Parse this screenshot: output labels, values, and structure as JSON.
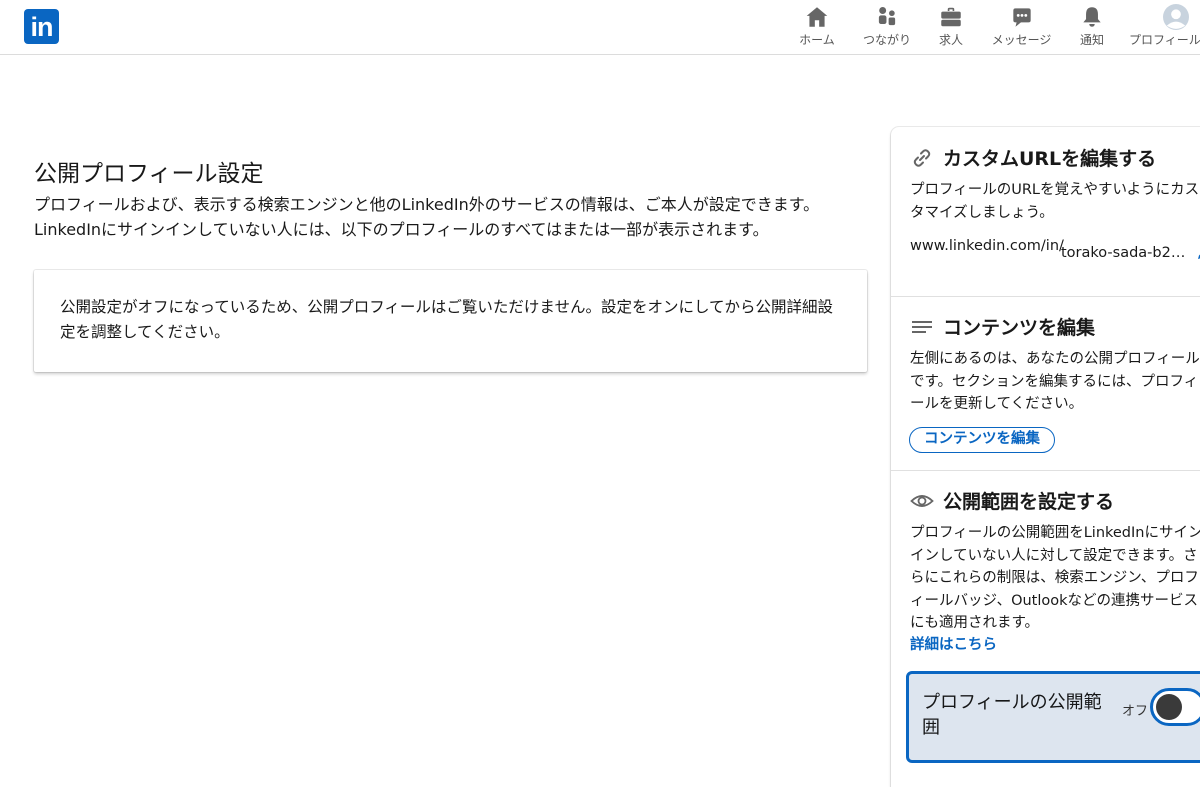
{
  "nav": {
    "logo": "in",
    "items": [
      {
        "label": "ホーム",
        "icon": "home-icon"
      },
      {
        "label": "つながり",
        "icon": "people-icon"
      },
      {
        "label": "求人",
        "icon": "briefcase-icon"
      },
      {
        "label": "メッセージ",
        "icon": "chat-icon"
      },
      {
        "label": "通知",
        "icon": "bell-icon"
      },
      {
        "label": "プロフィール",
        "icon": "avatar"
      }
    ]
  },
  "main": {
    "title": "公開プロフィール設定",
    "description": "プロフィールおよび、表示する検索エンジンと他のLinkedIn外のサービスの情報は、ご本人が設定できます。LinkedInにサインインしていない人には、以下のプロフィールのすべてはまたは一部が表示されます。",
    "notice": "公開設定がオフになっているため、公開プロフィールはご覧いただけません。設定をオンにしてから公開詳細設定を調整してください。"
  },
  "sidebar": {
    "custom_url": {
      "title": "カスタムURLを編集する",
      "body": "プロフィールのURLを覚えやすいようにカスタマイズしましょう。",
      "url_prefix": "www.linkedin.com/in/",
      "url_slug": "torako-sada-b2…",
      "icon": "link-icon"
    },
    "content": {
      "title": "コンテンツを編集",
      "body": "左側にあるのは、あなたの公開プロフィールです。セクションを編集するには、プロフィールを更新してください。",
      "button": "コンテンツを編集",
      "icon": "list-icon"
    },
    "visibility": {
      "title": "公開範囲を設定する",
      "body": "プロフィールの公開範囲をLinkedInにサインインしていない人に対して設定できます。さらにこれらの制限は、検索エンジン、プロフィールバッジ、Outlookなどの連携サービスにも適用されます。",
      "link": "詳細はこちら",
      "toggle_label": "プロフィールの公開範囲",
      "toggle_state": "オフ",
      "toggle_on": false,
      "icon": "eye-icon"
    }
  },
  "colors": {
    "brand": "#0a66c2",
    "nav_icon": "#666666",
    "toggle_bg": "#dde5ef"
  }
}
